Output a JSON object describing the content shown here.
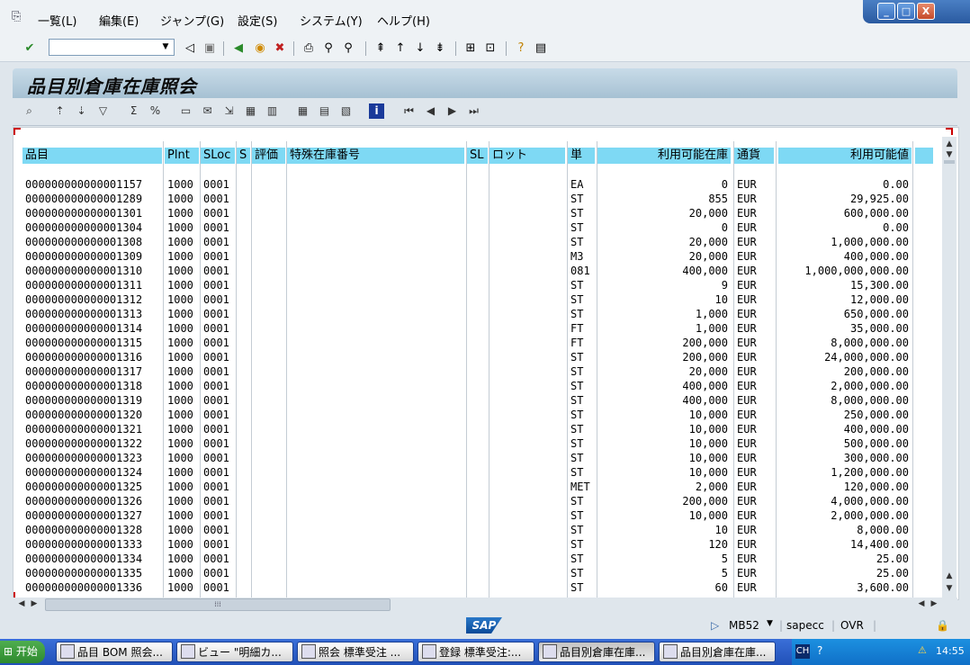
{
  "menu": {
    "items": [
      "一覧(L)",
      "編集(E)",
      "ジャンプ(G)",
      "設定(S)",
      "システム(Y)",
      "ヘルプ(H)"
    ]
  },
  "window_controls": {
    "min": "_",
    "max": "□",
    "close": "X"
  },
  "toolbar": {
    "command_value": ""
  },
  "title": "品目別倉庫在庫照会",
  "table": {
    "headers": {
      "material": "品目",
      "plant": "Plnt",
      "sloc": "SLoc",
      "s": "S",
      "valuation": "評価",
      "special_stock": "特殊在庫番号",
      "sl": "SL",
      "batch": "ロット",
      "unit": "単",
      "available_qty": "利用可能在庫",
      "currency": "通貨",
      "available_value": "利用可能値"
    },
    "rows": [
      {
        "material": "000000000000001157",
        "plant": "1000",
        "sloc": "0001",
        "unit": "EA",
        "qty": "0",
        "currency": "EUR",
        "value": "0.00"
      },
      {
        "material": "000000000000001289",
        "plant": "1000",
        "sloc": "0001",
        "unit": "ST",
        "qty": "855",
        "currency": "EUR",
        "value": "29,925.00"
      },
      {
        "material": "000000000000001301",
        "plant": "1000",
        "sloc": "0001",
        "unit": "ST",
        "qty": "20,000",
        "currency": "EUR",
        "value": "600,000.00"
      },
      {
        "material": "000000000000001304",
        "plant": "1000",
        "sloc": "0001",
        "unit": "ST",
        "qty": "0",
        "currency": "EUR",
        "value": "0.00"
      },
      {
        "material": "000000000000001308",
        "plant": "1000",
        "sloc": "0001",
        "unit": "ST",
        "qty": "20,000",
        "currency": "EUR",
        "value": "1,000,000.00"
      },
      {
        "material": "000000000000001309",
        "plant": "1000",
        "sloc": "0001",
        "unit": "M3",
        "qty": "20,000",
        "currency": "EUR",
        "value": "400,000.00"
      },
      {
        "material": "000000000000001310",
        "plant": "1000",
        "sloc": "0001",
        "unit": "081",
        "qty": "400,000",
        "currency": "EUR",
        "value": "1,000,000,000.00"
      },
      {
        "material": "000000000000001311",
        "plant": "1000",
        "sloc": "0001",
        "unit": "ST",
        "qty": "9",
        "currency": "EUR",
        "value": "15,300.00"
      },
      {
        "material": "000000000000001312",
        "plant": "1000",
        "sloc": "0001",
        "unit": "ST",
        "qty": "10",
        "currency": "EUR",
        "value": "12,000.00"
      },
      {
        "material": "000000000000001313",
        "plant": "1000",
        "sloc": "0001",
        "unit": "ST",
        "qty": "1,000",
        "currency": "EUR",
        "value": "650,000.00"
      },
      {
        "material": "000000000000001314",
        "plant": "1000",
        "sloc": "0001",
        "unit": "FT",
        "qty": "1,000",
        "currency": "EUR",
        "value": "35,000.00"
      },
      {
        "material": "000000000000001315",
        "plant": "1000",
        "sloc": "0001",
        "unit": "FT",
        "qty": "200,000",
        "currency": "EUR",
        "value": "8,000,000.00"
      },
      {
        "material": "000000000000001316",
        "plant": "1000",
        "sloc": "0001",
        "unit": "ST",
        "qty": "200,000",
        "currency": "EUR",
        "value": "24,000,000.00"
      },
      {
        "material": "000000000000001317",
        "plant": "1000",
        "sloc": "0001",
        "unit": "ST",
        "qty": "20,000",
        "currency": "EUR",
        "value": "200,000.00"
      },
      {
        "material": "000000000000001318",
        "plant": "1000",
        "sloc": "0001",
        "unit": "ST",
        "qty": "400,000",
        "currency": "EUR",
        "value": "2,000,000.00"
      },
      {
        "material": "000000000000001319",
        "plant": "1000",
        "sloc": "0001",
        "unit": "ST",
        "qty": "400,000",
        "currency": "EUR",
        "value": "8,000,000.00"
      },
      {
        "material": "000000000000001320",
        "plant": "1000",
        "sloc": "0001",
        "unit": "ST",
        "qty": "10,000",
        "currency": "EUR",
        "value": "250,000.00"
      },
      {
        "material": "000000000000001321",
        "plant": "1000",
        "sloc": "0001",
        "unit": "ST",
        "qty": "10,000",
        "currency": "EUR",
        "value": "400,000.00"
      },
      {
        "material": "000000000000001322",
        "plant": "1000",
        "sloc": "0001",
        "unit": "ST",
        "qty": "10,000",
        "currency": "EUR",
        "value": "500,000.00"
      },
      {
        "material": "000000000000001323",
        "plant": "1000",
        "sloc": "0001",
        "unit": "ST",
        "qty": "10,000",
        "currency": "EUR",
        "value": "300,000.00"
      },
      {
        "material": "000000000000001324",
        "plant": "1000",
        "sloc": "0001",
        "unit": "ST",
        "qty": "10,000",
        "currency": "EUR",
        "value": "1,200,000.00"
      },
      {
        "material": "000000000000001325",
        "plant": "1000",
        "sloc": "0001",
        "unit": "MET",
        "qty": "2,000",
        "currency": "EUR",
        "value": "120,000.00"
      },
      {
        "material": "000000000000001326",
        "plant": "1000",
        "sloc": "0001",
        "unit": "ST",
        "qty": "200,000",
        "currency": "EUR",
        "value": "4,000,000.00"
      },
      {
        "material": "000000000000001327",
        "plant": "1000",
        "sloc": "0001",
        "unit": "ST",
        "qty": "10,000",
        "currency": "EUR",
        "value": "2,000,000.00"
      },
      {
        "material": "000000000000001328",
        "plant": "1000",
        "sloc": "0001",
        "unit": "ST",
        "qty": "10",
        "currency": "EUR",
        "value": "8,000.00"
      },
      {
        "material": "000000000000001333",
        "plant": "1000",
        "sloc": "0001",
        "unit": "ST",
        "qty": "120",
        "currency": "EUR",
        "value": "14,400.00"
      },
      {
        "material": "000000000000001334",
        "plant": "1000",
        "sloc": "0001",
        "unit": "ST",
        "qty": "5",
        "currency": "EUR",
        "value": "25.00"
      },
      {
        "material": "000000000000001335",
        "plant": "1000",
        "sloc": "0001",
        "unit": "ST",
        "qty": "5",
        "currency": "EUR",
        "value": "25.00"
      },
      {
        "material": "000000000000001336",
        "plant": "1000",
        "sloc": "0001",
        "unit": "ST",
        "qty": "60",
        "currency": "EUR",
        "value": "3,600.00"
      }
    ]
  },
  "status": {
    "sap_logo": "SAP",
    "transaction": "MB52",
    "server": "sapecc",
    "mode": "OVR"
  },
  "taskbar": {
    "start": "开始",
    "tasks": [
      "品目 BOM 照会...",
      "ビュー \"明細カ...",
      "照会 標準受注 ...",
      "登録 標準受注:...",
      "品目別倉庫在庫...",
      "品目別倉庫在庫..."
    ],
    "ime": "CH",
    "clock": "14:55"
  }
}
